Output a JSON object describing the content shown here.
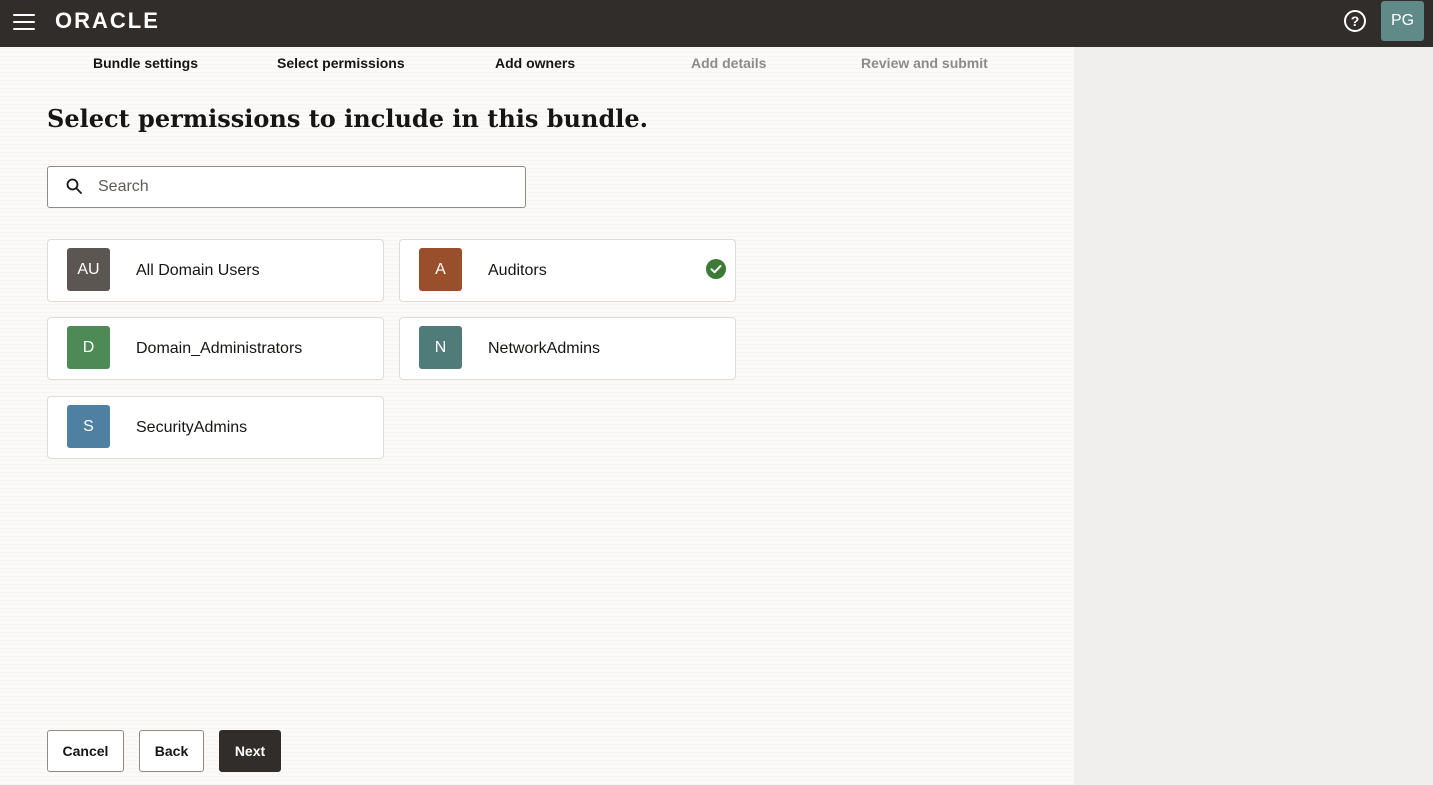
{
  "header": {
    "brand": "ORACLE",
    "help_glyph": "?",
    "avatar_initials": "PG",
    "menu_icon": "hamburger-menu-icon",
    "help_icon": "help-circle-icon"
  },
  "steps": [
    {
      "label": "Bundle settings",
      "state": "completed"
    },
    {
      "label": "Select permissions",
      "state": "current"
    },
    {
      "label": "Add owners",
      "state": "upcoming"
    },
    {
      "label": "Add details",
      "state": "disabled"
    },
    {
      "label": "Review and submit",
      "state": "disabled"
    }
  ],
  "page": {
    "heading": "Select permissions to include in this bundle."
  },
  "search": {
    "placeholder": "Search",
    "value": "",
    "icon": "search-icon"
  },
  "permissions": [
    {
      "initials": "AU",
      "name": "All Domain Users",
      "selected": false,
      "color": "#5b5651"
    },
    {
      "initials": "A",
      "name": "Auditors",
      "selected": true,
      "color": "#9a4f2c"
    },
    {
      "initials": "D",
      "name": "Domain_Administrators",
      "selected": false,
      "color": "#4e8a55"
    },
    {
      "initials": "N",
      "name": "NetworkAdmins",
      "selected": false,
      "color": "#4f7b78"
    },
    {
      "initials": "S",
      "name": "SecurityAdmins",
      "selected": false,
      "color": "#4f7fa1"
    }
  ],
  "actions": {
    "cancel": "Cancel",
    "back": "Back",
    "next": "Next"
  },
  "colors": {
    "header_bg": "#312d2a",
    "selected_check": "#3c7a35",
    "primary_button": "#312d2a"
  }
}
